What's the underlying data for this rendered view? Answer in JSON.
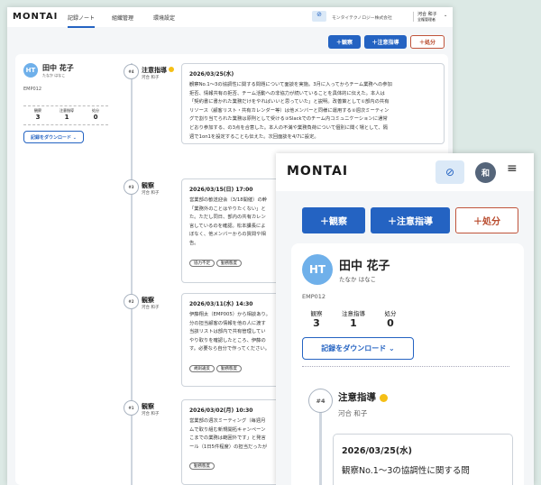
{
  "desktop": {
    "logo": "MONTAI",
    "tabs": [
      "記録ノート",
      "組織管理",
      "環境設定"
    ],
    "company": "モンタイテクノロジー株式会社",
    "user_name": "河合 和子",
    "user_role": "全権管理者",
    "buttons": {
      "observe": "＋観察",
      "guidance": "＋注意指導",
      "discipline": "＋処分"
    },
    "profile": {
      "initials": "HT",
      "name": "田中 花子",
      "kana": "たなか はなこ",
      "emp_id": "EMP012",
      "stats": [
        {
          "label": "観察",
          "value": "3"
        },
        {
          "label": "注意指導",
          "value": "1"
        },
        {
          "label": "処分",
          "value": "0"
        }
      ],
      "download": "記録をダウンロード ⌄"
    },
    "records": [
      {
        "no": "#4",
        "type": "注意指導",
        "author": "河合 和子",
        "date": "2026/03/25(水)",
        "text": "観察No.1〜3の協調性に関する問題について面談を実施。3月に入ってからチーム業務への参加\n拒否、情報共有の拒否、チーム活動への非協力が続いていることを具体的に伝えた。本人は\n「契約書に書かれた業務だけをやればいいと思っていた」と説明。改善策として①部内の共有\nリソース（顧客リスト・共有カレンダー等）は他メンバーと同様に運用する②週次ミーティン\nグで割り当てられた業務は原則として受ける③Slackでのチーム内コミュニケーションに通常\nどおり参加する、の3点を合意した。本人の不満や業務負荷について個別に聞く場として、隔\n週で1on1を設定することも伝えた。次回面談を4/7に設定。",
        "tags": []
      },
      {
        "no": "#3",
        "type": "観察",
        "author": "河合 和子",
        "date": "2026/03/15(日) 17:00",
        "text": "営業部の歓送迎会（3/18開催）の幹\n「業務外のことはやりたくない」と\nた。ただし同日、部内の共有カレン\n言しているのを確認。松本課長によ\nぼなく、他メンバーからの質問や相\n告。",
        "tags": [
          "協力不足",
          "勤務態度"
        ]
      },
      {
        "no": "#2",
        "type": "観察",
        "author": "河合 和子",
        "date": "2026/03/11(水) 14:30",
        "text": "伊藤翔太（EMP005）から相談あり。\n分の担当顧客の情報を他の人に渡す\n当該リストは部内で共有管理してい\nやり取りを確認したところ、伊藤の\nす。必要なら自分で作ってください。",
        "tags": [
          "規則違反",
          "勤務態度"
        ]
      },
      {
        "no": "#1",
        "type": "観察",
        "author": "河合 和子",
        "date": "2026/03/02(月) 10:30",
        "text": "営業部の週次ミーティング（毎週月\nムで取り組む新規開拓キャンペーン\nこまでの業務は範囲外です」と発言\nール（1日5件程度）の担当だったが",
        "tags": [
          "勤務態度"
        ]
      }
    ]
  },
  "mobile": {
    "logo": "MONTAI",
    "avatar": "和",
    "buttons": {
      "observe": "＋観察",
      "guidance": "＋注意指導",
      "discipline": "＋処分"
    },
    "profile": {
      "initials": "HT",
      "name": "田中 花子",
      "kana": "たなか はなこ",
      "emp_id": "EMP012",
      "stats": [
        {
          "label": "観察",
          "value": "3"
        },
        {
          "label": "注意指導",
          "value": "1"
        },
        {
          "label": "処分",
          "value": "0"
        }
      ],
      "download": "記録をダウンロード ⌄"
    },
    "record": {
      "no": "#4",
      "type": "注意指導",
      "author": "河合 和子",
      "date": "2026/03/25(水)",
      "text": "観察No.1〜3の協調性に関する問"
    }
  },
  "colors": {
    "primary": "#2463c2",
    "danger": "#c0533a",
    "status": "#f5bf16"
  }
}
